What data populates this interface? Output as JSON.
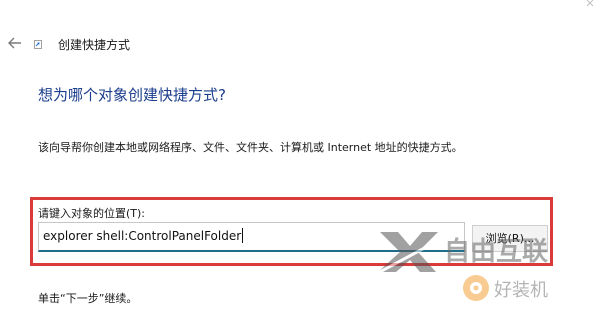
{
  "window": {
    "title": "创建快捷方式",
    "back_icon": "back-arrow-icon",
    "app_icon": "shortcut-icon"
  },
  "wizard": {
    "heading": "想为哪个对象创建快捷方式?",
    "description": "该向导帮你创建本地或网络程序、文件、文件夹、计算机或 Internet 地址的快捷方式。",
    "location_label": "请键入对象的位置(T):",
    "location_value": "explorer shell:ControlPanelFolder",
    "browse_label": "浏览(R)...",
    "next_hint": "单击“下一步”继续。"
  },
  "highlight": {
    "color": "#d93a3a"
  },
  "watermark": {
    "brand": "自由互联",
    "sub": "好装机"
  },
  "colors": {
    "heading": "#1a3d8c",
    "input_underline": "#1f6f8b"
  }
}
